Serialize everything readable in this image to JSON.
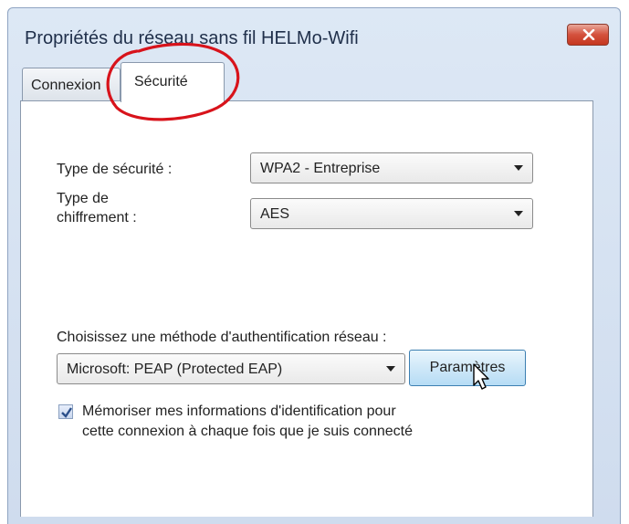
{
  "window": {
    "title": "Propriétés du réseau sans fil HELMo-Wifi",
    "close_icon": "close-icon"
  },
  "tabs": [
    {
      "label": "Connexion",
      "selected": false
    },
    {
      "label": "Sécurité",
      "selected": true
    }
  ],
  "security": {
    "type_label": "Type de sécurité :",
    "type_value": "WPA2 - Entreprise",
    "encryption_label_line1": "Type de",
    "encryption_label_line2": "chiffrement :",
    "encryption_value": "AES"
  },
  "auth": {
    "label": "Choisissez une méthode d'authentification réseau :",
    "method_value": "Microsoft: PEAP (Protected EAP)",
    "settings_button": "Paramètres"
  },
  "remember": {
    "checked": true,
    "line1": "Mémoriser mes informations d'identification pour",
    "line2": "cette connexion à chaque fois que je suis connecté"
  },
  "colors": {
    "annotation": "#d8131b",
    "accent": "#3c7fb1"
  }
}
